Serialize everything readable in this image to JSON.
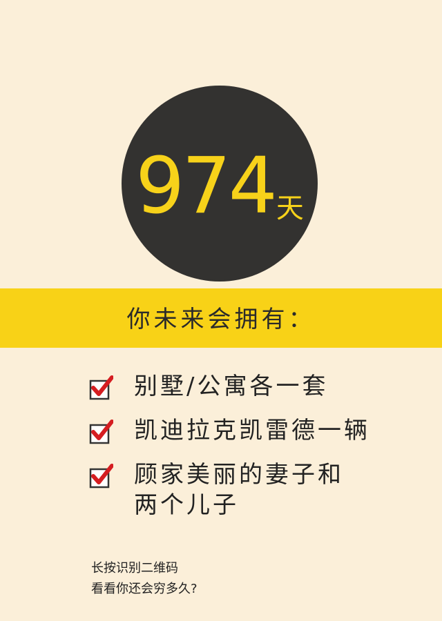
{
  "hero": {
    "days_number": "974",
    "days_unit": "天"
  },
  "banner": {
    "title": "你未来会拥有："
  },
  "list": {
    "items": [
      {
        "text": "别墅/公寓各一套",
        "icon": "checkbox-checked-icon"
      },
      {
        "text": "凯迪拉克凯雷德一辆",
        "icon": "checkbox-checked-icon"
      },
      {
        "text": "顾家美丽的妻子和两个儿子",
        "icon": "checkbox-checked-icon"
      }
    ]
  },
  "footer": {
    "line1": "长按识别二维码",
    "line2": "看看你还会穷多久?"
  },
  "colors": {
    "background": "#fbefd9",
    "circle": "#333230",
    "accent_yellow": "#f8d217",
    "check_red": "#d51d21"
  }
}
